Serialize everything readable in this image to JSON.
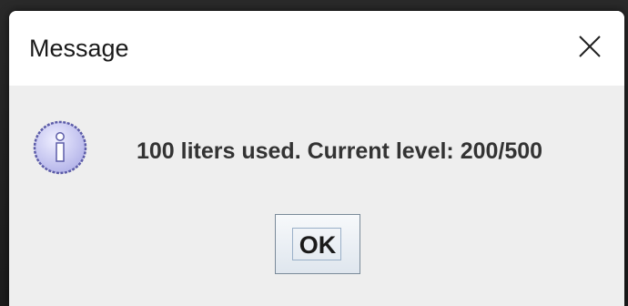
{
  "dialog": {
    "title": "Message",
    "message": "100 liters used. Current level: 200/500",
    "icon": "info-icon",
    "ok_label": "OK",
    "close_icon": "close-icon"
  },
  "colors": {
    "title_bar": "#ffffff",
    "body": "#eeeeee",
    "icon_fill": "#c7c7f2",
    "icon_border": "#6b6bb0"
  }
}
